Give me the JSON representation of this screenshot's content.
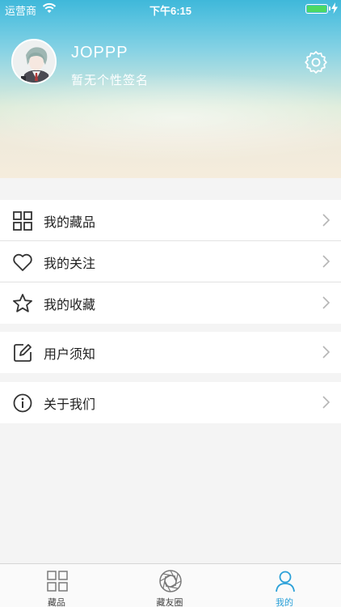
{
  "status_bar": {
    "carrier": "运营商",
    "time": "下午6:15",
    "battery_level": 1.0
  },
  "profile": {
    "username": "JOPPP",
    "signature": "暂无个性签名"
  },
  "menu_groups": [
    {
      "items": [
        {
          "label": "我的藏品",
          "icon": "grid-icon"
        },
        {
          "label": "我的关注",
          "icon": "heart-icon"
        },
        {
          "label": "我的收藏",
          "icon": "star-icon"
        }
      ]
    },
    {
      "items": [
        {
          "label": "用户须知",
          "icon": "edit-icon"
        }
      ]
    },
    {
      "items": [
        {
          "label": "关于我们",
          "icon": "info-icon"
        }
      ]
    }
  ],
  "tab_bar": {
    "tabs": [
      {
        "label": "藏品",
        "icon": "grid-icon",
        "active": false
      },
      {
        "label": "藏友圈",
        "icon": "circle-aperture-icon",
        "active": false
      },
      {
        "label": "我的",
        "icon": "person-icon",
        "active": true
      }
    ],
    "active_color": "#2aa0d8"
  }
}
